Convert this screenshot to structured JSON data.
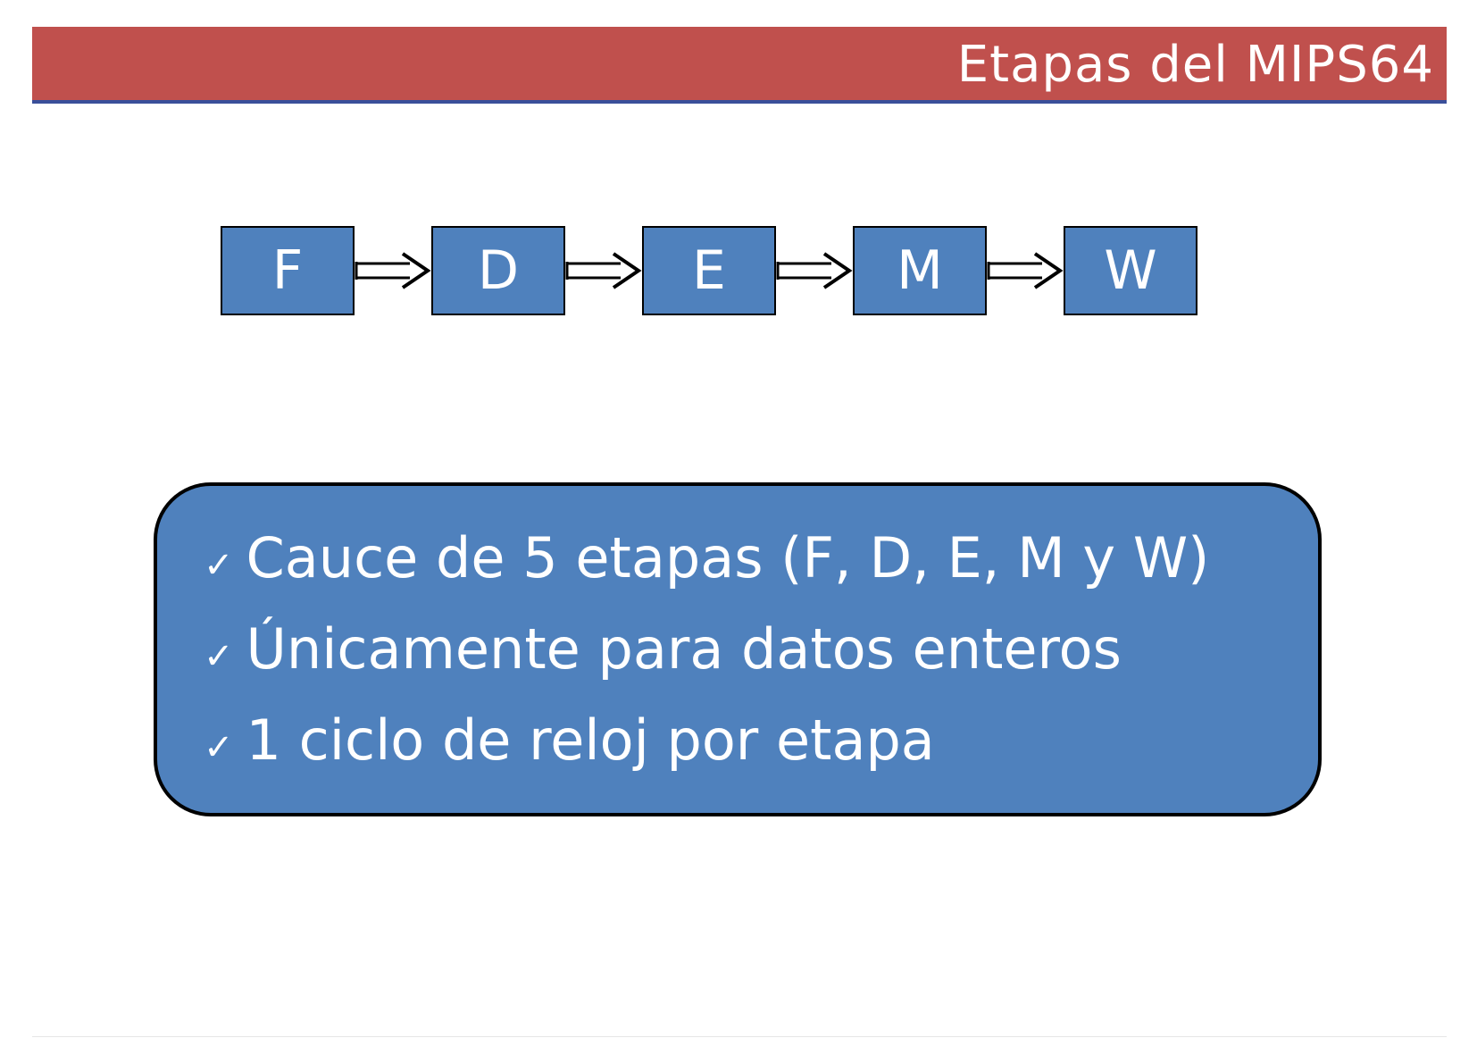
{
  "slide": {
    "title": "Etapas del MIPS64",
    "header_color": "#c0504d",
    "header_rule_color": "#3a4f9a"
  },
  "pipeline": {
    "box_color": "#4f81bd",
    "stages": [
      {
        "label": "F"
      },
      {
        "label": "D"
      },
      {
        "label": "E"
      },
      {
        "label": "M"
      },
      {
        "label": "W"
      }
    ],
    "connector_icon": "double-arrow-right-icon"
  },
  "info_box": {
    "bullet_icon": "check-icon",
    "bullet_glyph": "✓",
    "bullets": [
      "Cauce de 5 etapas (F, D, E, M y W)",
      "Únicamente para datos enteros",
      "1 ciclo de reloj por etapa"
    ]
  }
}
